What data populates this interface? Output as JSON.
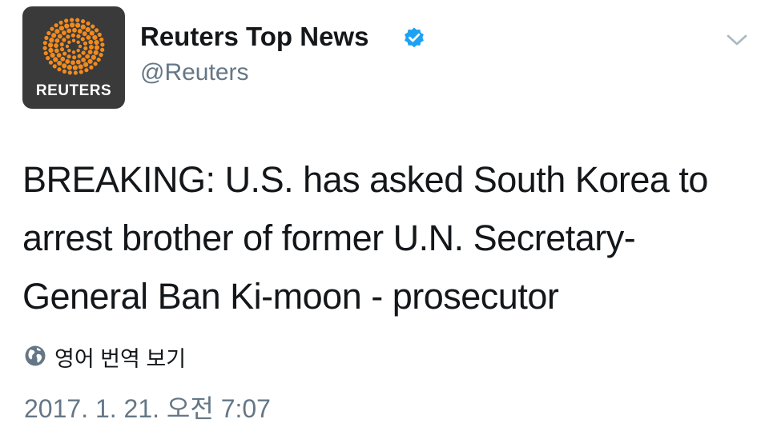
{
  "author": {
    "display_name": "Reuters Top News",
    "handle": "@Reuters",
    "avatar_label": "REUTERS",
    "verified": true
  },
  "tweet": {
    "lines": [
      "BREAKING: U.S. has asked South Korea to",
      "arrest brother of former U.N. Secretary-",
      "General Ban Ki-moon - prosecutor"
    ]
  },
  "translate": {
    "label": "영어 번역 보기",
    "icon": "globe-icon"
  },
  "timestamp": "2017. 1. 21. 오전 7:07",
  "colors": {
    "brand_orange": "#f28a1d",
    "avatar_bg": "#3a3a3a",
    "verified_blue": "#1da1f2",
    "secondary_text": "#657786",
    "primary_text": "#14171a"
  }
}
